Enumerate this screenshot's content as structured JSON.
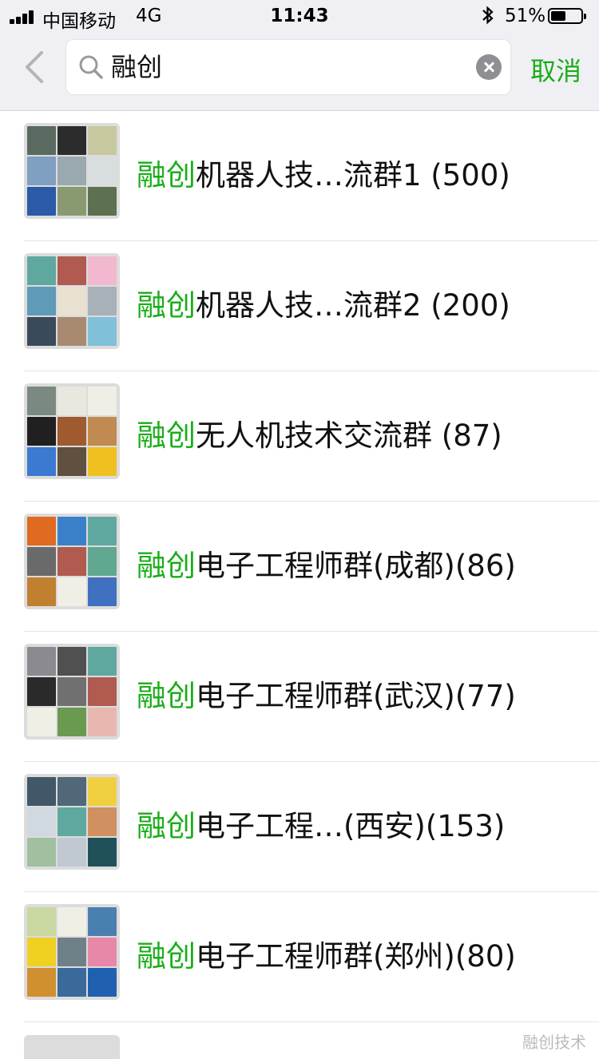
{
  "status_bar": {
    "carrier": "中国移动",
    "network": "4G",
    "time": "11:43",
    "battery_percent": "51%",
    "battery_level": 0.51
  },
  "header": {
    "search_value": "融创",
    "cancel_label": "取消"
  },
  "results": [
    {
      "highlight": "融创",
      "rest": "机器人技…流群1 (500)",
      "avatar": [
        "#5a6a60",
        "#2c2c2c",
        "#c8c8a0",
        "#7fa0c0",
        "#9aa8b0",
        "#d8dde0",
        "#2a5aa8",
        "#8a9a70",
        "#5d7050"
      ]
    },
    {
      "highlight": "融创",
      "rest": "机器人技…流群2 (200)",
      "avatar": [
        "#5fa8a0",
        "#b05a50",
        "#f2b8d0",
        "#5f9ab8",
        "#e8e0d0",
        "#a8b0b8",
        "#3a4a5a",
        "#a88a70",
        "#80c0d8"
      ]
    },
    {
      "highlight": "融创",
      "rest": "无人机技术交流群 (87)",
      "avatar": [
        "#7a8a80",
        "#e8e8e0",
        "#f0efe6",
        "#202020",
        "#a05a30",
        "#c08a50",
        "#3a7ad0",
        "#605040",
        "#f0c020"
      ]
    },
    {
      "highlight": "融创",
      "rest": "电子工程师群(成都)(86)",
      "avatar": [
        "#e06a20",
        "#3a80c8",
        "#5fa8a0",
        "#6a6a6a",
        "#b05a50",
        "#60a890",
        "#c08030",
        "#f0efe6",
        "#4070c0"
      ]
    },
    {
      "highlight": "融创",
      "rest": "电子工程师群(武汉)(77)",
      "avatar": [
        "#8a8a90",
        "#505050",
        "#5fa8a0",
        "#2a2a2a",
        "#707070",
        "#b05a50",
        "#f0efe6",
        "#6a9a50",
        "#e8b8b0"
      ]
    },
    {
      "highlight": "融创",
      "rest": "电子工程…(西安)(153)",
      "avatar": [
        "#405868",
        "#506878",
        "#f0d040",
        "#d0d8e0",
        "#5fa8a0",
        "#d09060",
        "#a0c0a0",
        "#c0c8d0",
        "#20505a"
      ]
    },
    {
      "highlight": "融创",
      "rest": "电子工程师群(郑州)(80)",
      "avatar": [
        "#c8d8a0",
        "#f0efe6",
        "#4a80b0",
        "#f0d020",
        "#708088",
        "#e888a8",
        "#d09030",
        "#3a6a9a",
        "#2060b0"
      ]
    }
  ],
  "watermark_text": "融创技术"
}
